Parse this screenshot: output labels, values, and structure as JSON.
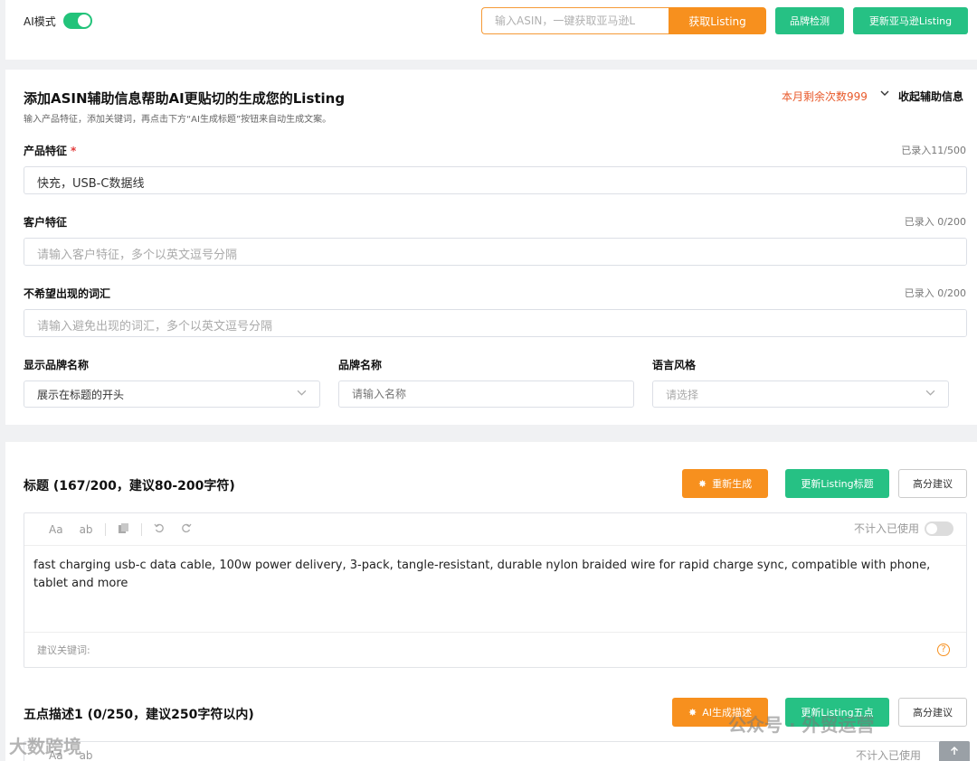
{
  "topbar": {
    "ai_mode_label": "AI模式",
    "asin_placeholder": "输入ASIN，一键获取亚马逊L",
    "fetch_button": "获取Listing",
    "brand_check_button": "品牌检测",
    "update_amazon_button": "更新亚马逊Listing"
  },
  "assist": {
    "title": "添加ASIN辅助信息帮助AI更贴切的生成您的Listing",
    "subtitle": "输入产品特征，添加关键词，再点击下方“AI生成标题”按钮来自动生成文案。",
    "remaining": "本月剩余次数999",
    "collapse_label": "收起辅助信息",
    "fields": [
      {
        "label": "产品特征",
        "required": "*",
        "counter": "已录入11/500",
        "value": "快充，USB-C数据线",
        "placeholder": ""
      },
      {
        "label": "客户特征",
        "counter": "已录入 0/200",
        "value": "",
        "placeholder": "请输入客户特征，多个以英文逗号分隔"
      },
      {
        "label": "不希望出现的词汇",
        "counter": "已录入 0/200",
        "value": "",
        "placeholder": "请输入避免出现的词汇，多个以英文逗号分隔"
      }
    ],
    "brand_display": {
      "label": "显示品牌名称",
      "value": "展示在标题的开头"
    },
    "brand_name": {
      "label": "品牌名称",
      "placeholder": "请输入名称"
    },
    "language_style": {
      "label": "语言风格",
      "placeholder": "请选择"
    }
  },
  "title_section": {
    "heading": "标题 (167/200，建议80-200字符)",
    "regen_button": "重新生成",
    "update_title_button": "更新Listing标题",
    "advice_button": "高分建议",
    "toolbar": {
      "font": "Aa",
      "case": "ab"
    },
    "not_count_label": "不计入已使用",
    "text": "fast charging usb-c data cable, 100w power delivery, 3-pack, tangle-resistant, durable nylon braided wire for rapid charge sync, compatible with phone, tablet and more",
    "keywords_label": "建议关键词:"
  },
  "bullet_section": {
    "heading": "五点描述1 (0/250，建议250字符以内)",
    "ai_button": "AI生成描述",
    "update_button": "更新Listing五点",
    "advice_button": "高分建议",
    "not_count_label": "不计入已使用"
  },
  "watermarks": {
    "left": "大数跨境",
    "right": "公众号 · 外贸运营"
  },
  "colors": {
    "accent_orange": "#f7901e",
    "accent_green": "#26c184",
    "warn_red": "#e8592a"
  }
}
